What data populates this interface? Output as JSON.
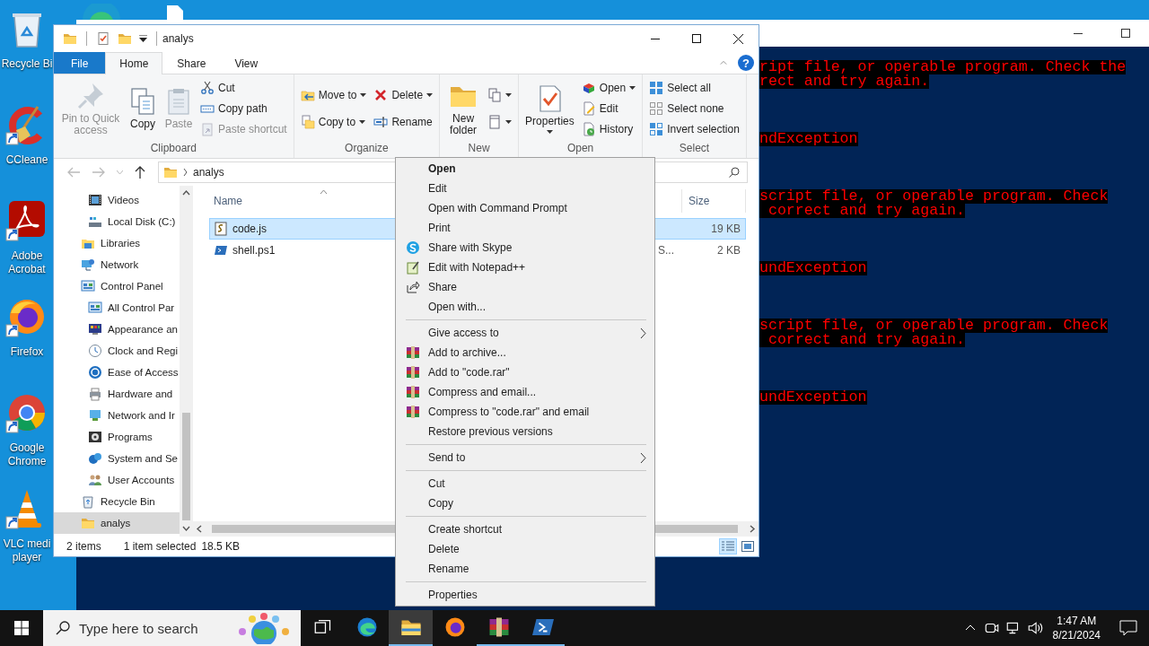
{
  "desktop": {
    "icons": [
      {
        "label": "Recycle Bi",
        "kind": "recycle",
        "shortcut": false
      },
      {
        "label": "CCleane",
        "kind": "ccleaner",
        "shortcut": true
      },
      {
        "label": "Adobe Acrobat",
        "kind": "acrobat",
        "shortcut": true
      },
      {
        "label": "Firefox",
        "kind": "firefox",
        "shortcut": true
      },
      {
        "label": "Google Chrome",
        "kind": "chrome",
        "shortcut": true
      },
      {
        "label": "VLC medi player",
        "kind": "vlc",
        "shortcut": true
      }
    ]
  },
  "console": {
    "blocks": [
      {
        "lines": [
          "ript file, or operable program. Check the",
          "rect and try again."
        ]
      },
      {
        "lines": [
          "ndException"
        ]
      },
      {
        "lines": [
          "script file, or operable program. Check",
          " correct and try again."
        ]
      },
      {
        "lines": [
          "undException"
        ]
      },
      {
        "lines": [
          "script file, or operable program. Check",
          " correct and try again."
        ]
      },
      {
        "lines": [
          "undException"
        ]
      }
    ]
  },
  "explorer": {
    "title": "analys",
    "help_button": "?",
    "tabs": [
      {
        "label": "File",
        "kind": "file",
        "selected": false
      },
      {
        "label": "Home",
        "kind": "tab",
        "selected": true
      },
      {
        "label": "Share",
        "kind": "tab",
        "selected": false
      },
      {
        "label": "View",
        "kind": "tab",
        "selected": false
      }
    ],
    "ribbon": {
      "groups": [
        {
          "label": "Clipboard",
          "columns": [
            {
              "kind": "large",
              "items": [
                {
                  "label": "Pin to Quick access",
                  "kind": "pin",
                  "disabled": true,
                  "dropdown": false
                }
              ]
            },
            {
              "kind": "large",
              "items": [
                {
                  "label": "Copy",
                  "kind": "copy",
                  "disabled": false,
                  "dropdown": false
                }
              ]
            },
            {
              "kind": "large",
              "items": [
                {
                  "label": "Paste",
                  "kind": "paste",
                  "disabled": true,
                  "dropdown": false
                }
              ]
            },
            {
              "kind": "small",
              "items": [
                {
                  "label": "Cut",
                  "kind": "scissors",
                  "disabled": false,
                  "dropdown": false
                },
                {
                  "label": "Copy path",
                  "kind": "copypath",
                  "disabled": false,
                  "dropdown": false
                },
                {
                  "label": "Paste shortcut",
                  "kind": "pasteshort",
                  "disabled": true,
                  "dropdown": false
                }
              ]
            }
          ]
        },
        {
          "label": "Organize",
          "columns": [
            {
              "kind": "small",
              "items": [
                {
                  "label": "Move to",
                  "kind": "moveto",
                  "disabled": false,
                  "dropdown": true
                },
                {
                  "label": "Copy to",
                  "kind": "copyto",
                  "disabled": false,
                  "dropdown": true
                }
              ]
            },
            {
              "kind": "small",
              "items": [
                {
                  "label": "Delete",
                  "kind": "delete",
                  "disabled": false,
                  "dropdown": true
                },
                {
                  "label": "Rename",
                  "kind": "rename",
                  "disabled": false,
                  "dropdown": false
                }
              ]
            }
          ]
        },
        {
          "label": "New",
          "columns": [
            {
              "kind": "large",
              "items": [
                {
                  "label": "New folder",
                  "kind": "folder",
                  "disabled": false,
                  "dropdown": false
                }
              ]
            },
            {
              "kind": "small",
              "items": [
                {
                  "kind": "newitem",
                  "disabled": false,
                  "dropdown": true
                },
                {
                  "kind": "easyaccess",
                  "disabled": false,
                  "dropdown": true
                }
              ]
            }
          ]
        },
        {
          "label": "Open",
          "columns": [
            {
              "kind": "large",
              "items": [
                {
                  "label": "Properties",
                  "kind": "properties",
                  "disabled": false,
                  "dropdown": true
                }
              ]
            },
            {
              "kind": "small",
              "items": [
                {
                  "label": "Open",
                  "kind": "open",
                  "disabled": false,
                  "dropdown": true
                },
                {
                  "label": "Edit",
                  "kind": "edit",
                  "disabled": false,
                  "dropdown": false
                },
                {
                  "label": "History",
                  "kind": "history",
                  "disabled": false,
                  "dropdown": false
                }
              ]
            }
          ]
        },
        {
          "label": "Select",
          "columns": [
            {
              "kind": "small",
              "items": [
                {
                  "label": "Select all",
                  "kind": "selectall",
                  "disabled": false,
                  "dropdown": false
                },
                {
                  "label": "Select none",
                  "kind": "selectnone",
                  "disabled": false,
                  "dropdown": false
                },
                {
                  "label": "Invert selection",
                  "kind": "invert",
                  "disabled": false,
                  "dropdown": false
                }
              ]
            }
          ]
        }
      ]
    },
    "address": {
      "path": "analys"
    },
    "nav": {
      "upper_children": [
        {
          "label": "Videos",
          "kind": "video",
          "selected": false
        },
        {
          "label": "Local Disk (C:)",
          "kind": "disk",
          "selected": false
        }
      ],
      "items": [
        {
          "label": "Libraries",
          "kind": "library",
          "selected": false
        },
        {
          "label": "Network",
          "kind": "network",
          "selected": false
        },
        {
          "label": "Control Panel",
          "kind": "panel",
          "selected": false,
          "children": [
            {
              "label": "All Control Par",
              "kind": "panel",
              "selected": false
            },
            {
              "label": "Appearance an",
              "kind": "appearance",
              "selected": false
            },
            {
              "label": "Clock and Regi",
              "kind": "clock",
              "selected": false
            },
            {
              "label": "Ease of Access",
              "kind": "access",
              "selected": false
            },
            {
              "label": "Hardware and",
              "kind": "hardware",
              "selected": false
            },
            {
              "label": "Network and Ir",
              "kind": "netinternet",
              "selected": false
            },
            {
              "label": "Programs",
              "kind": "programs",
              "selected": false
            },
            {
              "label": "System and Se",
              "kind": "system",
              "selected": false
            },
            {
              "label": "User Accounts",
              "kind": "users",
              "selected": false
            }
          ]
        },
        {
          "label": "Recycle Bin",
          "kind": "recycle",
          "selected": false
        },
        {
          "label": "analys",
          "kind": "folder",
          "selected": true
        }
      ]
    },
    "files": {
      "columns": [
        {
          "label": "Name",
          "sorted": true
        },
        {
          "label": "Size",
          "sorted": false
        }
      ],
      "rows": [
        {
          "name": "code.js",
          "kind": "js",
          "size": "19 KB",
          "selected": true
        },
        {
          "name": "shell.ps1",
          "kind": "ps",
          "column_3": "S...",
          "size": "2 KB",
          "selected": false
        }
      ]
    },
    "status": {
      "count": "2 items",
      "selection": "1 item selected",
      "size": "18.5 KB"
    },
    "view_buttons": [
      {
        "kind": "details",
        "selected": true
      },
      {
        "kind": "large-icons",
        "selected": false
      }
    ]
  },
  "context_menu": {
    "sections": [
      {
        "items": [
          {
            "label": "Open",
            "kind": "plain",
            "default": true,
            "submenu": false
          },
          {
            "label": "Edit",
            "kind": "plain",
            "default": false,
            "submenu": false
          },
          {
            "label": "Open with Command Prompt",
            "kind": "plain",
            "default": false,
            "submenu": false
          },
          {
            "label": "Print",
            "kind": "plain",
            "default": false,
            "submenu": false
          },
          {
            "label": "Share with Skype",
            "kind": "skype",
            "default": false,
            "submenu": false
          },
          {
            "label": "Edit with Notepad++",
            "kind": "notepad",
            "default": false,
            "submenu": false
          },
          {
            "label": "Share",
            "kind": "share",
            "default": false,
            "submenu": false
          },
          {
            "label": "Open with...",
            "kind": "plain",
            "default": false,
            "submenu": false
          }
        ]
      },
      {
        "items": [
          {
            "label": "Give access to",
            "kind": "plain",
            "default": false,
            "submenu": true
          },
          {
            "label": "Add to archive...",
            "kind": "winrar",
            "default": false,
            "submenu": false
          },
          {
            "label": "Add to \"code.rar\"",
            "kind": "winrar",
            "default": false,
            "submenu": false
          },
          {
            "label": "Compress and email...",
            "kind": "winrar",
            "default": false,
            "submenu": false
          },
          {
            "label": "Compress to \"code.rar\" and email",
            "kind": "winrar",
            "default": false,
            "submenu": false
          },
          {
            "label": "Restore previous versions",
            "kind": "plain",
            "default": false,
            "submenu": false
          }
        ]
      },
      {
        "items": [
          {
            "label": "Send to",
            "kind": "plain",
            "default": false,
            "submenu": true
          }
        ]
      },
      {
        "items": [
          {
            "label": "Cut",
            "kind": "plain",
            "default": false,
            "submenu": false
          },
          {
            "label": "Copy",
            "kind": "plain",
            "default": false,
            "submenu": false
          }
        ]
      },
      {
        "items": [
          {
            "label": "Create shortcut",
            "kind": "plain",
            "default": false,
            "submenu": false
          },
          {
            "label": "Delete",
            "kind": "plain",
            "default": false,
            "submenu": false
          },
          {
            "label": "Rename",
            "kind": "plain",
            "default": false,
            "submenu": false
          }
        ]
      },
      {
        "items": [
          {
            "label": "Properties",
            "kind": "plain",
            "default": false,
            "submenu": false
          }
        ]
      }
    ]
  },
  "taskbar": {
    "search": {
      "placeholder": "Type here to search"
    },
    "apps": [
      {
        "kind": "taskview",
        "selected": false,
        "running": false
      },
      {
        "kind": "edge",
        "selected": false,
        "running": false
      },
      {
        "kind": "explorer",
        "selected": true,
        "running": true
      },
      {
        "kind": "firefox",
        "selected": false,
        "running": false
      },
      {
        "kind": "winrar",
        "selected": false,
        "running": true
      },
      {
        "kind": "powershell",
        "selected": false,
        "running": true
      }
    ],
    "tray": [
      {
        "kind": "chevron"
      },
      {
        "kind": "meet"
      },
      {
        "kind": "network"
      },
      {
        "kind": "volume"
      }
    ],
    "clock": {
      "time": "1:47 AM",
      "date": "8/21/2024"
    }
  }
}
